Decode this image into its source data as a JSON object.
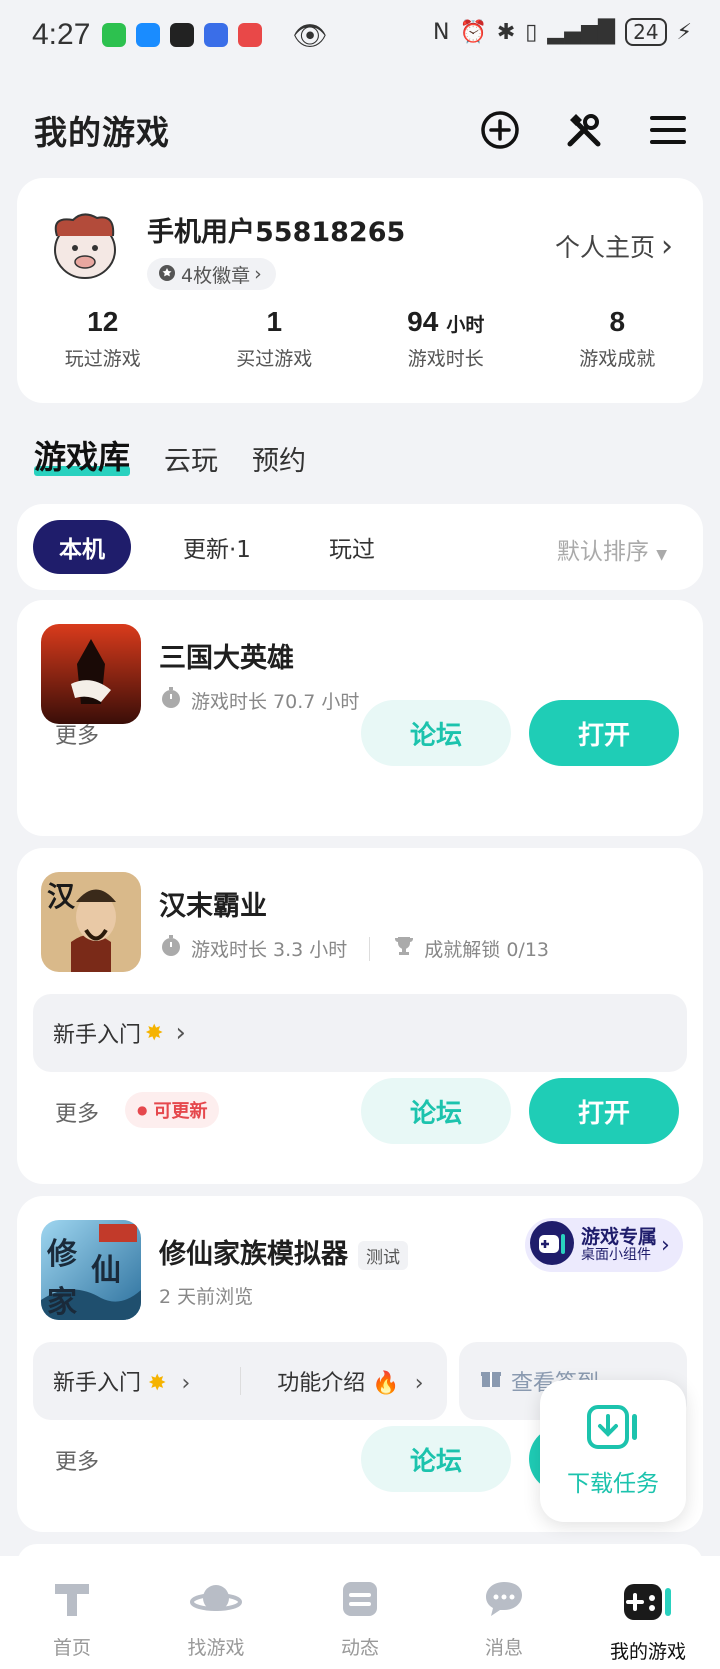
{
  "status_bar": {
    "time": "4:27",
    "battery": "24"
  },
  "header": {
    "title": "我的游戏",
    "icons": [
      "add-circle-icon",
      "tools-icon",
      "menu-icon"
    ]
  },
  "profile": {
    "username": "手机用户55818265",
    "badges": "4枚徽章",
    "homepage_link": "个人主页",
    "stats": [
      {
        "value": "12",
        "unit": "",
        "label": "玩过游戏"
      },
      {
        "value": "1",
        "unit": "",
        "label": "买过游戏"
      },
      {
        "value": "94",
        "unit": "小时",
        "label": "游戏时长"
      },
      {
        "value": "8",
        "unit": "",
        "label": "游戏成就"
      }
    ]
  },
  "library_tabs": [
    "游戏库",
    "云玩",
    "预约"
  ],
  "filters": {
    "chips": [
      "本机",
      "更新·1",
      "玩过"
    ],
    "sort": "默认排序"
  },
  "games": [
    {
      "name": "三国大英雄",
      "playtime": "游戏时长 70.7 小时",
      "more": "更多",
      "forum": "论坛",
      "open": "打开"
    },
    {
      "name": "汉末霸业",
      "playtime": "游戏时长 3.3 小时",
      "achievement": "成就解锁 0/13",
      "guide": "新手入门",
      "more": "更多",
      "update_badge": "可更新",
      "forum": "论坛",
      "open": "打开"
    },
    {
      "name": "修仙家族模拟器",
      "tag": "测试",
      "last_seen": "2 天前浏览",
      "widget_title": "游戏专属",
      "widget_sub": "桌面小组件",
      "guide": "新手入门",
      "features": "功能介绍",
      "signin": "查看签到",
      "more": "更多",
      "forum": "论坛"
    }
  ],
  "float_button": {
    "label": "下载任务"
  },
  "bottom_nav": [
    {
      "label": "首页",
      "icon": "home-icon"
    },
    {
      "label": "找游戏",
      "icon": "planet-icon"
    },
    {
      "label": "动态",
      "icon": "feed-icon"
    },
    {
      "label": "消息",
      "icon": "message-icon"
    },
    {
      "label": "我的游戏",
      "icon": "gamepad-icon"
    }
  ],
  "colors": {
    "accent": "#1fcdb6",
    "navy": "#1f1d6b",
    "update_red": "#e5484d"
  }
}
